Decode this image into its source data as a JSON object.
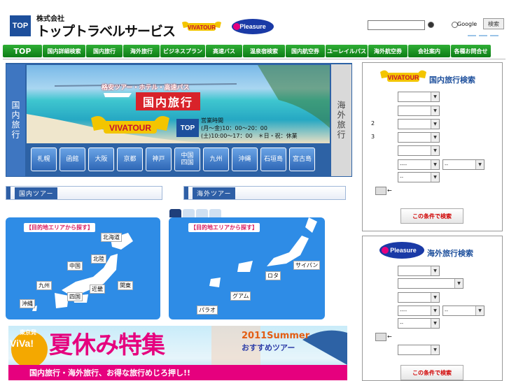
{
  "header": {
    "logo": "TOP",
    "company_prefix": "株式会社",
    "company_name": "トップトラベルサービス",
    "google_label": "Google",
    "search_button": "検索"
  },
  "nav": [
    "TOP",
    "国内詳細検索",
    "国内旅行",
    "海外旅行",
    "ビジネスプラン",
    "高速バス",
    "温泉宿検索",
    "国内航空券",
    "ユーレイルパス",
    "海外航空券",
    "会社案内",
    "各種お問合せ"
  ],
  "hero": {
    "left_tab": "国内旅行",
    "right_tab": "海外旅行",
    "subtitle": "格安ツアー・ホテル・高速バス",
    "title": "国内旅行",
    "hours_title": "営業時間",
    "hours_weekday": "(月～金)10：00～20：00",
    "hours_sat": "(土)10:00～17：00　＊日・祝：休業",
    "cities": [
      "札幌",
      "函館",
      "大阪",
      "京都",
      "神戸",
      "中国\n四国",
      "九州",
      "沖縄",
      "石垣島",
      "宮古島"
    ]
  },
  "sections": {
    "domestic": "国内ツアー",
    "overseas": "海外ツアー"
  },
  "maps": {
    "domestic": {
      "label": "【目的地エリアから探す】",
      "pins": [
        "北海道",
        "北陸",
        "中国",
        "九州",
        "近畿",
        "関東",
        "四国",
        "沖縄"
      ]
    },
    "overseas": {
      "label": "【目的地エリアから探す】",
      "pins": [
        "サイパン",
        "ロタ",
        "グアム",
        "パラオ"
      ]
    }
  },
  "banner": {
    "badge_top": "東京発",
    "badge_main": "ViVa!",
    "big": "夏休み特集",
    "mid1": "2011Summer",
    "mid2": "おすすめツアー",
    "bottom": "国内旅行・海外旅行、お得な旅行めじろ押し!!"
  },
  "domestic_search": {
    "title": "国内旅行検索",
    "row_labels": [
      "2",
      "3"
    ],
    "date_default": "----",
    "date_default2": "--",
    "arrow": "←",
    "submit": "この条件で検索"
  },
  "overseas_search": {
    "title": "海外旅行検索",
    "date_default": "----",
    "date_default2": "--",
    "arrow": "←",
    "submit": "この条件で検索"
  },
  "colors": {
    "nav_green": "#0d7d16",
    "hero_blue": "#2d62a5",
    "brand_pink": "#e6007e",
    "map_blue": "#2e8ce6"
  }
}
